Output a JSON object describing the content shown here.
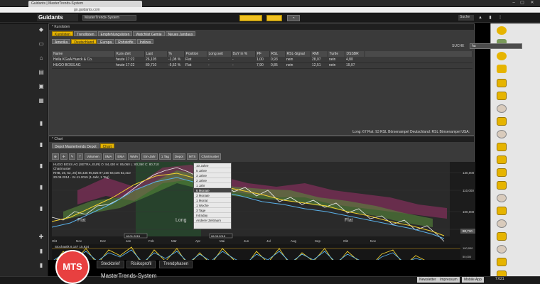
{
  "browser": {
    "tab_title": "Guidants | MasterTrends-System",
    "url": "go.guidants.com"
  },
  "header": {
    "logo": "Guidants",
    "system_select": "MasterTrends-System",
    "search_label": "Suche"
  },
  "watchlist": {
    "title": "* Kurslisten",
    "tabs": [
      "Kurslisten",
      "Trendlisten",
      "Empfehlungslisten",
      "Watchlist Gemie",
      "Neues Jandaus"
    ],
    "region_tabs": [
      "Amerika",
      "Deutschland",
      "Europa",
      "Rohstoffe",
      "Indizes"
    ],
    "active_region": "Deutschland",
    "search_value": "hu",
    "search_label": "SUCHE",
    "columns": [
      "Name",
      "Kurs-Zeit",
      "Last",
      "%",
      "Position",
      "Long seit",
      "DaY in %",
      "PF",
      "RSL",
      "RSL-Signal",
      "RMI",
      "Turtle",
      "DSSBR"
    ],
    "rows": [
      [
        "Hella KGaA Hueck & Co.",
        "heute 17:22",
        "26,105",
        "-1,08 %",
        "Flat",
        "-",
        "-",
        "1,00",
        "0,93",
        "nein",
        "28,07",
        "nein",
        "4,80"
      ],
      [
        "HUGO BOSS AG",
        "heute 17:22",
        "80,710",
        "-5,52 %",
        "Flat",
        "-",
        "-",
        "7,90",
        "0,85",
        "nein",
        "12,51",
        "nein",
        "19,07"
      ]
    ],
    "status": "Long: 67   Flat: 93   RSL Börsenampel Deutschland:   RSL Börsenampel USA:"
  },
  "chart": {
    "title": "* Chart",
    "tabs": [
      "Depot Mastertrends Depot",
      "Chart"
    ],
    "toolbar": [
      "Volumen",
      "SMA",
      "EMA",
      "WMA",
      "Ein-Jahr",
      "1 Tag",
      "Depot",
      "MTS",
      "Chartmuster"
    ],
    "info_line_1": "HUGO BOSS AG (XETRA, EUR) O: 84,430 H: 85,060 L: 80,360 C: 80,710",
    "info_line_2": "Chartmuster",
    "info_line_3": "RHB, 26, 52, 26) 84,435 95,825 97,160 84,025 82,410",
    "info_line_4": "20.09.2014 - 24.11.2015 (1 Jahr, 1 Tag)",
    "zones": [
      "Flat",
      "Long",
      "Flat"
    ],
    "x_labels": [
      "Okt",
      "Nov",
      "Dez",
      "Jan",
      "Feb",
      "Mär",
      "Apr",
      "Mai",
      "Jun",
      "Jul",
      "Aug",
      "Sep",
      "Okt",
      "Nov"
    ],
    "y_labels": [
      "130,000",
      "110,000",
      "100,000",
      "80,710"
    ],
    "date_marker_1": "18.01.2015",
    "date_marker_2": "06.05.2015",
    "sub_y_labels": [
      "100,000",
      "50,000",
      "20,000"
    ],
    "sub_info": "Stochastik  8,147  15,924",
    "dropdown": [
      "10 Jahre",
      "5 Jahre",
      "3 Jahre",
      "2 Jahre",
      "1 Jahr",
      "6 Monate",
      "3 Monate",
      "1 Monat",
      "1 Woche",
      "3 Tage",
      "Intraday",
      "Anderer Zeitraum"
    ],
    "dropdown_selected": 5
  },
  "bottom": {
    "logo": "MTS",
    "tabs": [
      "Steckbrief",
      "Risikoprofil",
      "Trendphasen"
    ],
    "title": "MasterTrends-System",
    "links": [
      "Newsletter",
      "Impressum",
      "Mobile App"
    ],
    "time": "7:621"
  }
}
